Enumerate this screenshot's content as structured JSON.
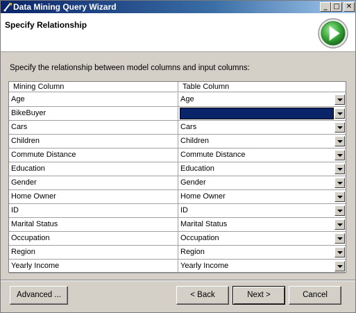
{
  "window": {
    "title": "Data Mining Query Wizard",
    "buttons": {
      "minimize": "_",
      "maximize": "□",
      "close": "✕"
    }
  },
  "header": {
    "page_title": "Specify Relationship",
    "graphic_icon": "green-forward-arrow-icon"
  },
  "instruction": "Specify the relationship between model columns and input columns:",
  "grid": {
    "columns": [
      "Mining Column",
      "Table Column"
    ],
    "rows": [
      {
        "mining": "Age",
        "table": "Age"
      },
      {
        "mining": "BikeBuyer",
        "table": ""
      },
      {
        "mining": "Cars",
        "table": "Cars"
      },
      {
        "mining": "Children",
        "table": "Children"
      },
      {
        "mining": "Commute Distance",
        "table": "Commute Distance"
      },
      {
        "mining": "Education",
        "table": "Education"
      },
      {
        "mining": "Gender",
        "table": "Gender"
      },
      {
        "mining": "Home Owner",
        "table": "Home Owner"
      },
      {
        "mining": "ID",
        "table": "ID"
      },
      {
        "mining": "Marital Status",
        "table": "Marital Status"
      },
      {
        "mining": "Occupation",
        "table": "Occupation"
      },
      {
        "mining": "Region",
        "table": "Region"
      },
      {
        "mining": "Yearly Income",
        "table": "Yearly Income"
      }
    ],
    "selected_row": 1
  },
  "footer": {
    "advanced": "Advanced ...",
    "back": "< Back",
    "next": "Next >",
    "cancel": "Cancel"
  },
  "colors": {
    "title_bar": "#0a246a",
    "selection": "#0a246a",
    "face": "#d4d0c8"
  }
}
